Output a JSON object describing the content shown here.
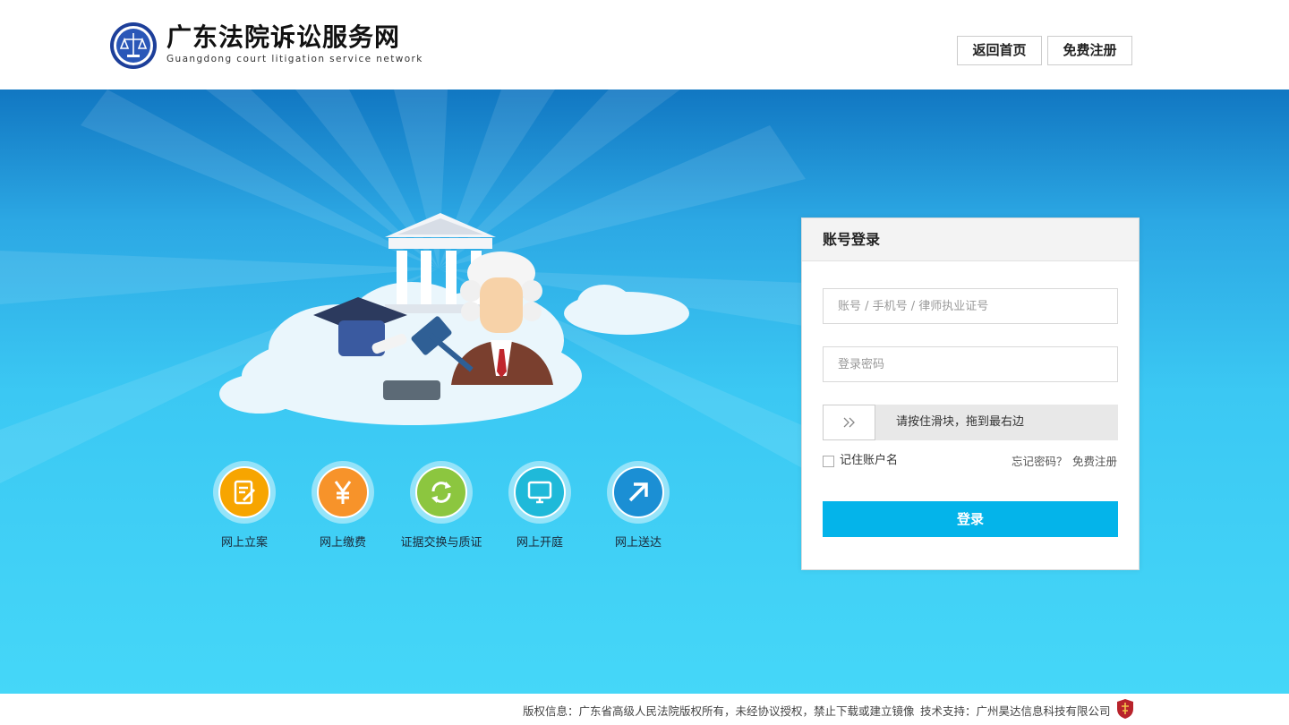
{
  "header": {
    "title": "广东法院诉讼服务网",
    "subtitle": "Guangdong court litigation service network",
    "home_button": "返回首页",
    "register_button": "免费注册"
  },
  "services": [
    {
      "label": "网上立案",
      "icon": "file-edit-icon",
      "color": "#f7a500"
    },
    {
      "label": "网上缴费",
      "icon": "yuan-icon",
      "color": "#f7932a"
    },
    {
      "label": "证据交换与质证",
      "icon": "exchange-icon",
      "color": "#8cc63f"
    },
    {
      "label": "网上开庭",
      "icon": "monitor-icon",
      "color": "#1fb9d9"
    },
    {
      "label": "网上送达",
      "icon": "arrow-up-right-icon",
      "color": "#1b8fd4"
    }
  ],
  "login": {
    "title": "账号登录",
    "account_placeholder": "账号 / 手机号 / 律师执业证号",
    "password_placeholder": "登录密码",
    "slider_hint": "请按住滑块，拖到最右边",
    "remember_label": "记住账户名",
    "forgot_link": "忘记密码？",
    "register_link": "免费注册",
    "submit_label": "登录"
  },
  "footer": {
    "copyright": "版权信息：广东省高级人民法院版权所有，未经协议授权，禁止下载或建立镜像",
    "tech_support": "技术支持：广州昊达信息科技有限公司"
  },
  "colors": {
    "accent": "#04b4ea",
    "hero_top": "#1177c2",
    "hero_bottom": "#45d7f8"
  }
}
